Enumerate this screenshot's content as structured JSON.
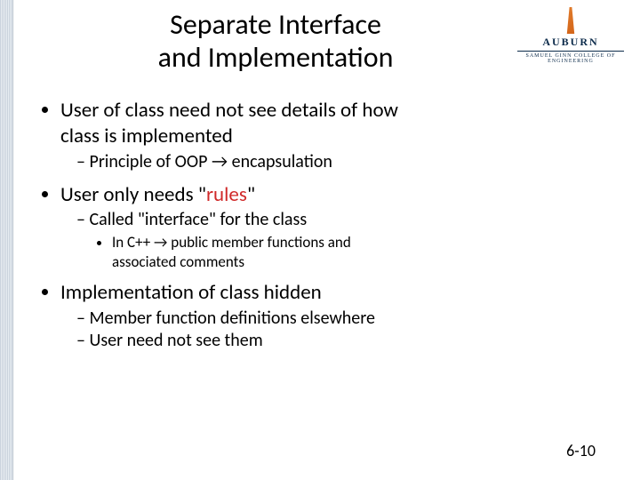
{
  "logo": {
    "name": "AUBURN",
    "sub": "SAMUEL GINN COLLEGE OF ENGINEERING"
  },
  "title_line1": "Separate Interface",
  "title_line2": "and Implementation",
  "b1_a": "User of class need not see details of how",
  "b1_b": "class is implemented",
  "b1_sub1": "Principle of OOP → encapsulation",
  "b2_pre": "User only needs \"",
  "b2_hl": "rules",
  "b2_post": "\"",
  "b2_sub1": "Called \"interface\" for the class",
  "b2_subsub_a": "In C++ → public member functions and",
  "b2_subsub_b": "associated comments",
  "b3": "Implementation of class hidden",
  "b3_sub1": "Member function definitions elsewhere",
  "b3_sub2": "User need not see them",
  "pagenum": "6-10"
}
